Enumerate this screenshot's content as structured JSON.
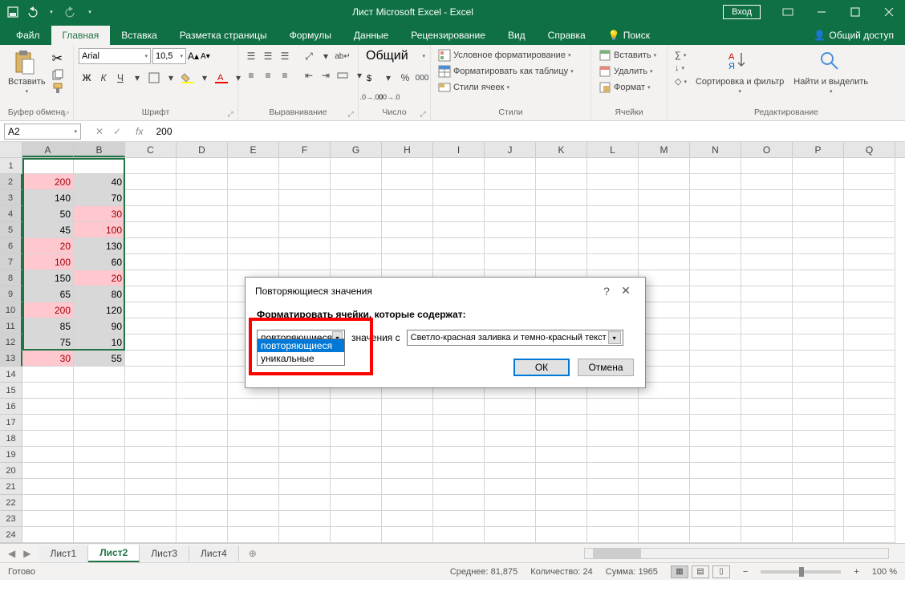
{
  "titlebar": {
    "title": "Лист Microsoft Excel  -  Excel",
    "login": "Вход"
  },
  "tabs": {
    "file": "Файл",
    "home": "Главная",
    "insert": "Вставка",
    "layout": "Разметка страницы",
    "formulas": "Формулы",
    "data": "Данные",
    "review": "Рецензирование",
    "view": "Вид",
    "help": "Справка",
    "search": "Поиск",
    "share": "Общий доступ"
  },
  "ribbon": {
    "clipboard": {
      "paste": "Вставить",
      "label": "Буфер обмена"
    },
    "font": {
      "name": "Arial",
      "size": "10,5",
      "label": "Шрифт"
    },
    "alignment": {
      "label": "Выравнивание"
    },
    "number": {
      "format": "Общий",
      "label": "Число"
    },
    "styles": {
      "cond": "Условное форматирование",
      "table": "Форматировать как таблицу",
      "cell": "Стили ячеек",
      "label": "Стили"
    },
    "cells": {
      "insert": "Вставить",
      "delete": "Удалить",
      "format": "Формат",
      "label": "Ячейки"
    },
    "editing": {
      "sort": "Сортировка и фильтр",
      "find": "Найти и выделить",
      "label": "Редактирование"
    }
  },
  "formula_bar": {
    "cell_ref": "A2",
    "value": "200"
  },
  "columns": [
    "A",
    "B",
    "C",
    "D",
    "E",
    "F",
    "G",
    "H",
    "I",
    "J",
    "K",
    "L",
    "M",
    "N",
    "O",
    "P",
    "Q"
  ],
  "row_count": 24,
  "selected_cols": [
    "A",
    "B"
  ],
  "selected_rows_from": 2,
  "selected_rows_to": 13,
  "data_rows": [
    {
      "r": 2,
      "a": "200",
      "b": "40",
      "a_dup": true
    },
    {
      "r": 3,
      "a": "140",
      "b": "70"
    },
    {
      "r": 4,
      "a": "50",
      "b": "30",
      "b_dup": true
    },
    {
      "r": 5,
      "a": "45",
      "b": "100",
      "b_dup": true
    },
    {
      "r": 6,
      "a": "20",
      "b": "130",
      "a_dup": true
    },
    {
      "r": 7,
      "a": "100",
      "b": "60",
      "a_dup": true
    },
    {
      "r": 8,
      "a": "150",
      "b": "20",
      "b_dup": true
    },
    {
      "r": 9,
      "a": "65",
      "b": "80"
    },
    {
      "r": 10,
      "a": "200",
      "b": "120",
      "a_dup": true
    },
    {
      "r": 11,
      "a": "85",
      "b": "90"
    },
    {
      "r": 12,
      "a": "75",
      "b": "10"
    },
    {
      "r": 13,
      "a": "30",
      "b": "55",
      "a_dup": true
    }
  ],
  "sheets": {
    "s1": "Лист1",
    "s2": "Лист2",
    "s3": "Лист3",
    "s4": "Лист4"
  },
  "status": {
    "ready": "Готово",
    "avg_label": "Среднее:",
    "avg": "81,875",
    "count_label": "Количество:",
    "count": "24",
    "sum_label": "Сумма:",
    "sum": "1965",
    "zoom": "100 %"
  },
  "dialog": {
    "title": "Повторяющиеся значения",
    "prompt": "Форматировать ячейки, которые содержат:",
    "combo_left": "повторяющиеся",
    "mid_label": "значения с",
    "combo_right": "Светло-красная заливка и темно-красный текст",
    "opt1": "повторяющиеся",
    "opt2": "уникальные",
    "ok": "ОК",
    "cancel": "Отмена"
  }
}
